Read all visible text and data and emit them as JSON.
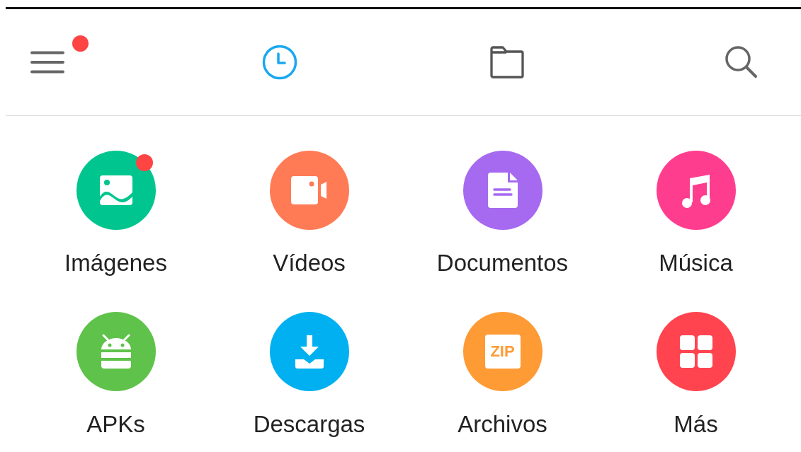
{
  "toolbar": {
    "menu": {
      "badge": true
    },
    "tabs": [
      {
        "kind": "recent",
        "selected": true
      },
      {
        "kind": "folder",
        "selected": false
      }
    ]
  },
  "categories": [
    {
      "label": "Imágenes",
      "kind": "images",
      "color": "#00c58e",
      "badge": true
    },
    {
      "label": "Vídeos",
      "kind": "videos",
      "color": "#ff7b55",
      "badge": false
    },
    {
      "label": "Documentos",
      "kind": "documents",
      "color": "#a66af0",
      "badge": false
    },
    {
      "label": "Música",
      "kind": "music",
      "color": "#ff3d8f",
      "badge": false
    },
    {
      "label": "APKs",
      "kind": "apks",
      "color": "#5fc24a",
      "badge": false
    },
    {
      "label": "Descargas",
      "kind": "downloads",
      "color": "#00b0f0",
      "badge": false
    },
    {
      "label": "Archivos",
      "kind": "zip",
      "color": "#ff9b35",
      "badge": false,
      "icon_text": "ZIP"
    },
    {
      "label": "Más",
      "kind": "more",
      "color": "#ff444f",
      "badge": false
    }
  ]
}
